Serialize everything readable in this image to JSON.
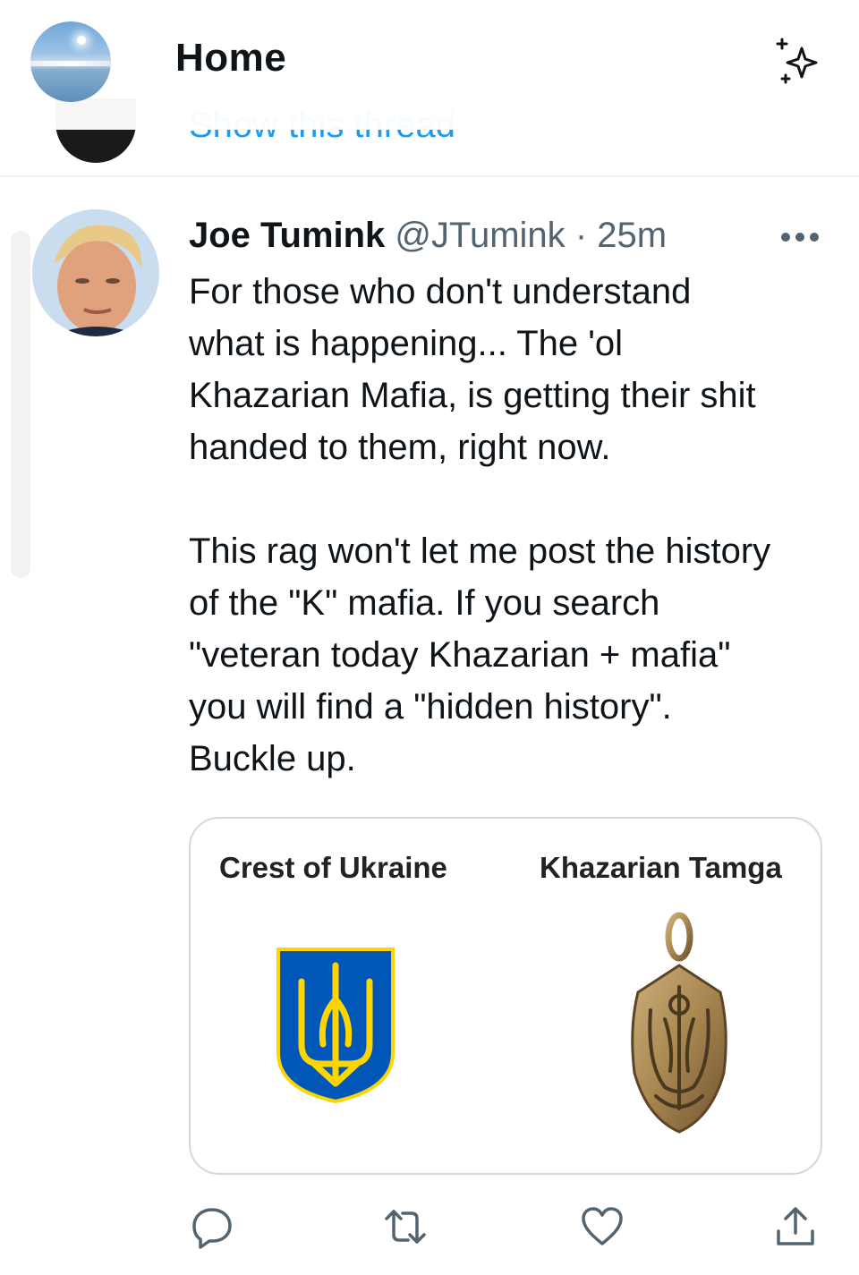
{
  "header": {
    "title": "Home"
  },
  "previous_tweet": {
    "show_thread_label": "Show this thread"
  },
  "tweet": {
    "author_name": "Joe Tumink",
    "author_handle": "@JTumink",
    "separator": "·",
    "time": "25m",
    "paragraph_1": "For those who don't understand\nwhat is happening... The 'ol\nKhazarian Mafia, is getting their shit\nhanded to them, right now.",
    "paragraph_2": "This rag won't let me post the history\nof the \"K\" mafia.  If you search\n\"veteran today Khazarian + mafia\"\nyou will find a \"hidden history\".\nBuckle up.",
    "media": {
      "left_caption": "Crest of Ukraine",
      "right_caption": "Khazarian Tamga"
    }
  },
  "actions": [
    "reply-icon",
    "retweet-icon",
    "like-icon",
    "share-icon"
  ],
  "colors": {
    "accent": "#1d9bf0",
    "text": "#0f1419",
    "secondary": "#536471",
    "crest_blue": "#0057b7",
    "crest_yellow": "#ffd500",
    "tamga_bronze": "#a88650"
  }
}
